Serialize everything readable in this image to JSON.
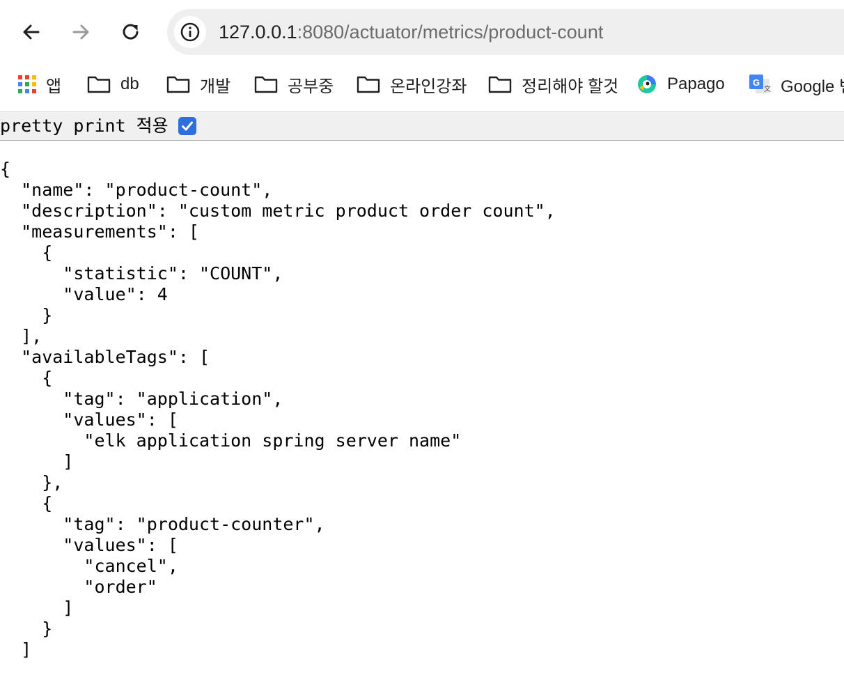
{
  "browser": {
    "url_host": "127.0.0.1",
    "url_rest": ":8080/actuator/metrics/product-count",
    "icons": {
      "back": "arrow-left-icon",
      "forward": "arrow-right-icon",
      "reload": "reload-icon",
      "site_info": "info-icon"
    }
  },
  "bookmarks": [
    {
      "label": "앱",
      "icon": "apps-grid-icon"
    },
    {
      "label": "db",
      "icon": "folder-icon"
    },
    {
      "label": "개발",
      "icon": "folder-icon"
    },
    {
      "label": "공부중",
      "icon": "folder-icon"
    },
    {
      "label": "온라인강좌",
      "icon": "folder-icon"
    },
    {
      "label": "정리해야 할것",
      "icon": "folder-icon"
    },
    {
      "label": "Papago",
      "icon": "papago-icon"
    },
    {
      "label": "Google 번",
      "icon": "google-translate-icon"
    }
  ],
  "pretty_print": {
    "label": "pretty print 적용",
    "checked": true
  },
  "json_lines": [
    "{",
    "  \"name\": \"product-count\",",
    "  \"description\": \"custom metric product order count\",",
    "  \"measurements\": [",
    "    {",
    "      \"statistic\": \"COUNT\",",
    "      \"value\": 4",
    "    }",
    "  ],",
    "  \"availableTags\": [",
    "    {",
    "      \"tag\": \"application\",",
    "      \"values\": [",
    "        \"elk application spring server name\"",
    "      ]",
    "    },",
    "    {",
    "      \"tag\": \"product-counter\",",
    "      \"values\": [",
    "        \"cancel\",",
    "        \"order\"",
    "      ]",
    "    }",
    "  ]",
    "}"
  ]
}
